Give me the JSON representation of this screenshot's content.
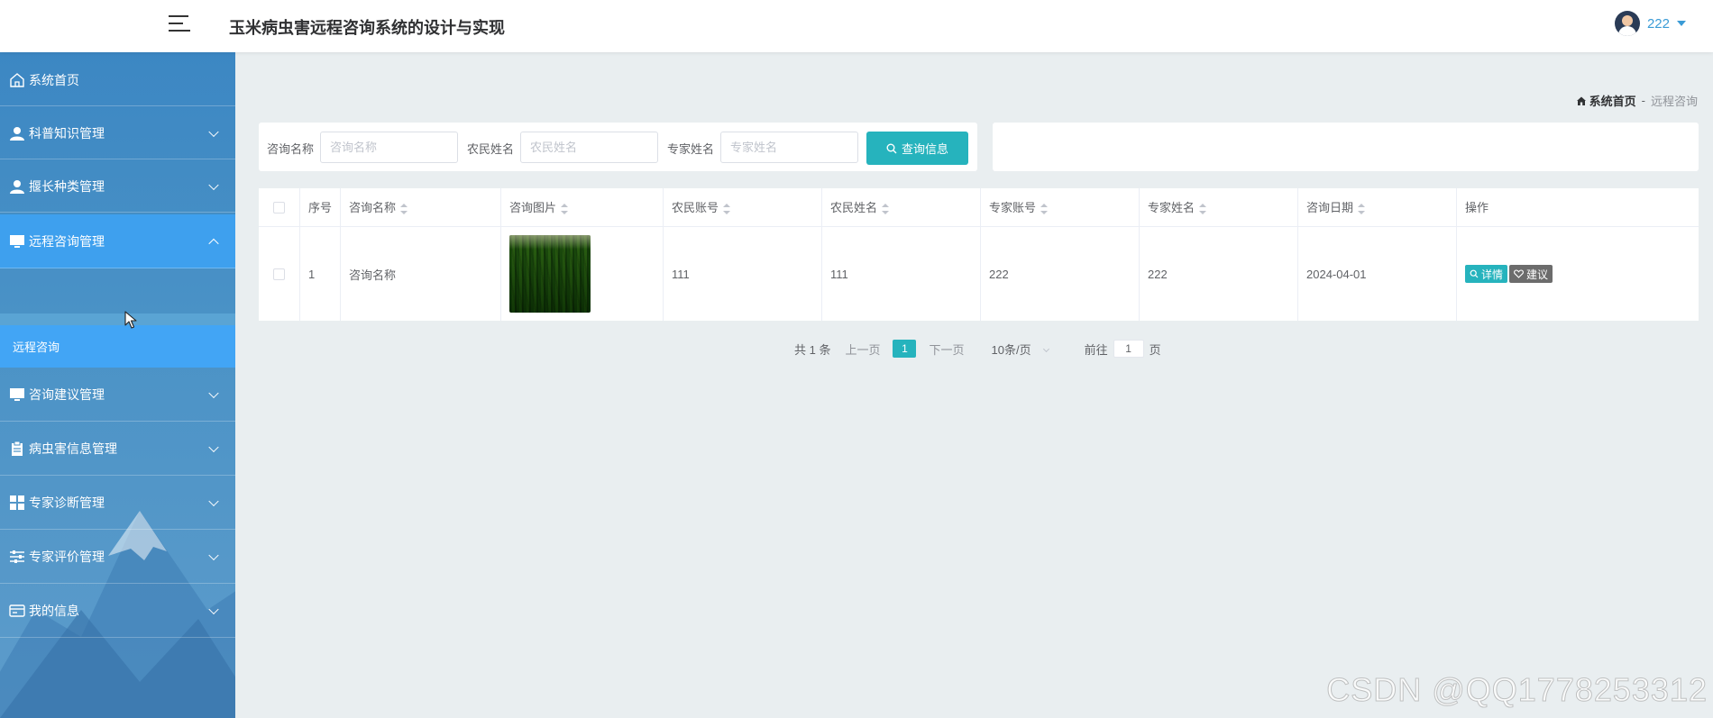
{
  "app": {
    "title": "玉米病虫害远程咨询系统的设计与实现"
  },
  "user": {
    "name": "222"
  },
  "sidebar": {
    "items": [
      {
        "label": "系统首页",
        "icon": "home-icon"
      },
      {
        "label": "科普知识管理",
        "icon": "user-icon"
      },
      {
        "label": "揠长种类管理",
        "icon": "user-icon"
      },
      {
        "label": "远程咨询管理",
        "icon": "monitor-icon",
        "open": true
      },
      {
        "label": "咨询建议管理",
        "icon": "monitor-icon"
      },
      {
        "label": "病虫害信息管理",
        "icon": "clipboard-icon"
      },
      {
        "label": "专家诊断管理",
        "icon": "grid-icon"
      },
      {
        "label": "专家评价管理",
        "icon": "sliders-icon"
      },
      {
        "label": "我的信息",
        "icon": "card-icon"
      }
    ],
    "submenu": {
      "label": "远程咨询"
    }
  },
  "breadcrumb": {
    "home": "系统首页",
    "separator": "-",
    "current": "远程咨询"
  },
  "search": {
    "consult_name_label": "咨询名称",
    "consult_name_placeholder": "咨询名称",
    "farmer_name_label": "农民姓名",
    "farmer_name_placeholder": "农民姓名",
    "expert_name_label": "专家姓名",
    "expert_name_placeholder": "专家姓名",
    "button_label": "查询信息"
  },
  "table": {
    "headers": [
      "序号",
      "咨询名称",
      "咨询图片",
      "农民账号",
      "农民姓名",
      "专家账号",
      "专家姓名",
      "咨询日期",
      "操作"
    ],
    "rows": [
      {
        "index": "1",
        "name": "咨询名称",
        "farmer_account": "111",
        "farmer_name": "111",
        "expert_account": "222",
        "expert_name": "222",
        "date": "2024-04-01"
      }
    ],
    "actions": {
      "detail": "详情",
      "suggest": "建议"
    }
  },
  "pagination": {
    "total": "共 1 条",
    "prev": "上一页",
    "current": "1",
    "next": "下一页",
    "page_size": "10条/页",
    "goto_prefix": "前往",
    "goto_value": "1",
    "goto_suffix": "页"
  },
  "watermark": "CSDN @QQ1778253312",
  "colors": {
    "accent": "#26b3bd",
    "sidebar": "#4a92c6",
    "sidebar_active": "#42a5f5"
  }
}
